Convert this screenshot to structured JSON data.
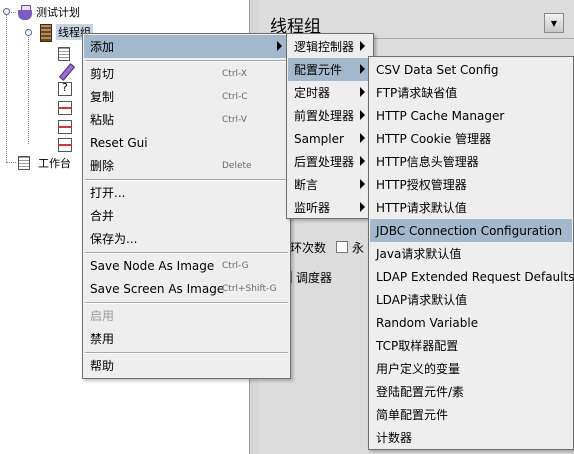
{
  "tree": {
    "test_plan": "测试计划",
    "thread_group": "线程组",
    "workbench": "工作台"
  },
  "panel": {
    "title": "线程组",
    "loop_fragment": "环次数",
    "forever_fragment": "永",
    "scheduler_label": "调度器"
  },
  "context_menu": {
    "items": [
      {
        "label": "添加",
        "has_submenu": true,
        "highlighted": true
      },
      {
        "label": "剪切",
        "shortcut": "Ctrl-X"
      },
      {
        "label": "复制",
        "shortcut": "Ctrl-C"
      },
      {
        "label": "粘贴",
        "shortcut": "Ctrl-V"
      },
      {
        "label": "Reset Gui"
      },
      {
        "label": "删除",
        "shortcut": "Delete"
      },
      {
        "label": "打开..."
      },
      {
        "label": "合并"
      },
      {
        "label": "保存为..."
      },
      {
        "label": "Save Node As Image",
        "shortcut": "Ctrl-G"
      },
      {
        "label": "Save Screen As Image",
        "shortcut": "Ctrl+Shift-G"
      },
      {
        "label": "启用",
        "disabled": true
      },
      {
        "label": "禁用"
      },
      {
        "label": "帮助"
      }
    ]
  },
  "add_submenu": {
    "items": [
      {
        "label": "逻辑控制器",
        "has_submenu": true
      },
      {
        "label": "配置元件",
        "has_submenu": true,
        "highlighted": true
      },
      {
        "label": "定时器",
        "has_submenu": true
      },
      {
        "label": "前置处理器",
        "has_submenu": true
      },
      {
        "label": "Sampler",
        "has_submenu": true
      },
      {
        "label": "后置处理器",
        "has_submenu": true
      },
      {
        "label": "断言",
        "has_submenu": true
      },
      {
        "label": "监听器",
        "has_submenu": true
      }
    ]
  },
  "config_submenu": {
    "items": [
      {
        "label": "CSV Data Set Config"
      },
      {
        "label": "FTP请求缺省值"
      },
      {
        "label": "HTTP Cache Manager"
      },
      {
        "label": "HTTP Cookie 管理器"
      },
      {
        "label": "HTTP信息头管理器"
      },
      {
        "label": "HTTP授权管理器"
      },
      {
        "label": "HTTP请求默认值"
      },
      {
        "label": "JDBC Connection Configuration",
        "highlighted": true
      },
      {
        "label": "Java请求默认值"
      },
      {
        "label": "LDAP Extended Request Defaults"
      },
      {
        "label": "LDAP请求默认值"
      },
      {
        "label": "Random Variable"
      },
      {
        "label": "TCP取样器配置"
      },
      {
        "label": "用户定义的变量"
      },
      {
        "label": "登陆配置元件/素"
      },
      {
        "label": "简单配置元件"
      },
      {
        "label": "计数器"
      }
    ]
  },
  "colors": {
    "highlight": "#a3b8cc",
    "menu_bg": "#eeeeee",
    "panel_bg": "#dcdcdc"
  }
}
